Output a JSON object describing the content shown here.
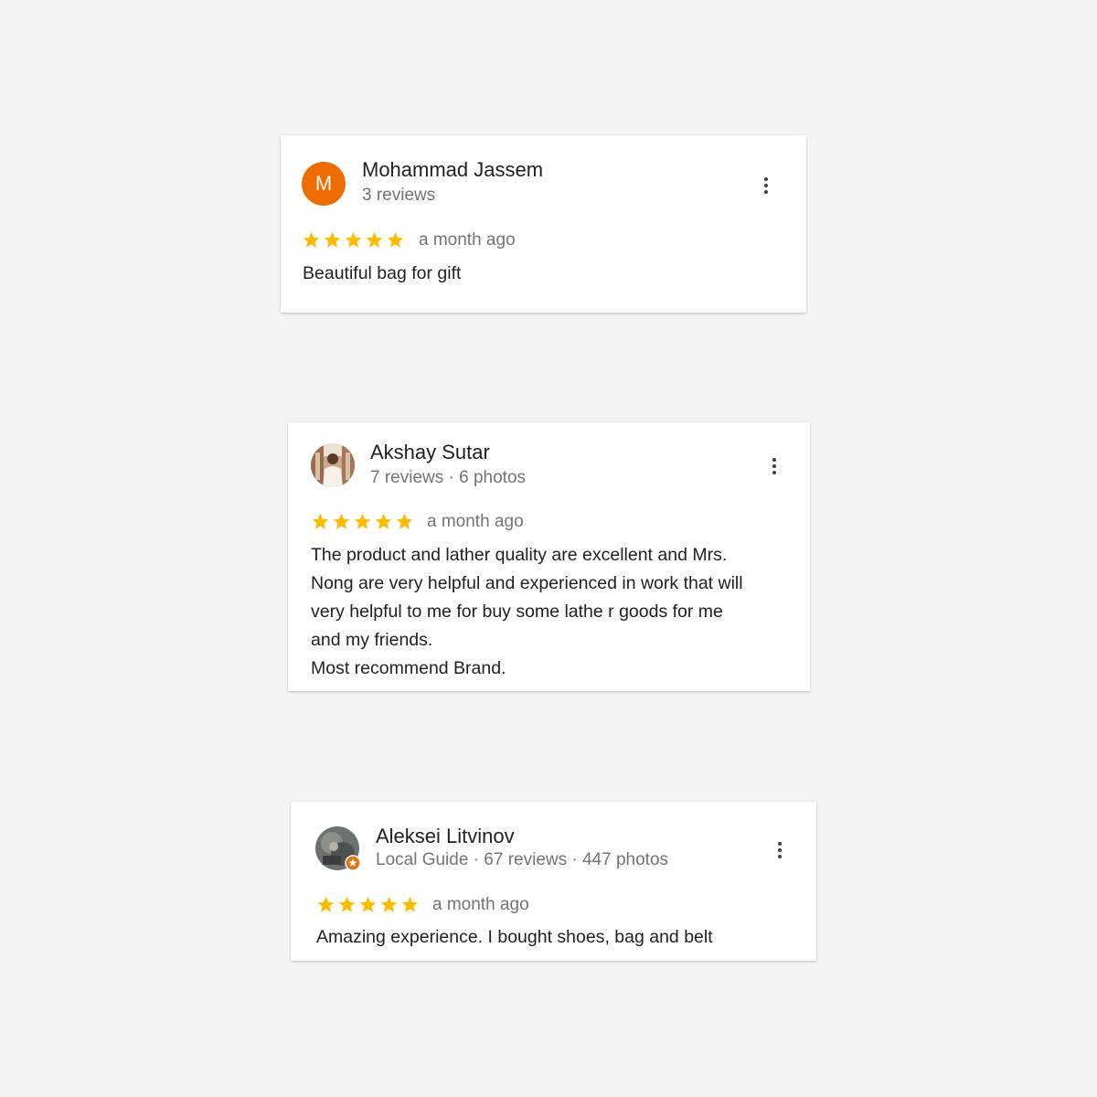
{
  "colors": {
    "background": "#f4f4f4",
    "star": "#fbbc04",
    "avatar_letter_bg": "#ef6c00",
    "meta_text": "#70757a",
    "local_guide_badge": "#e8710a"
  },
  "reviews": [
    {
      "author": "Mohammad Jassem",
      "avatar_letter": "M",
      "meta": "3 reviews",
      "rating": 5,
      "date": "a month ago",
      "text_lines": [
        "Beautiful bag for gift"
      ]
    },
    {
      "author": "Akshay Sutar",
      "avatar_icon": "profile-photo",
      "meta": "7 reviews · 6 photos",
      "rating": 5,
      "date": "a month ago",
      "text_lines": [
        "The product and lather quality are excellent and Mrs.",
        "Nong are very helpful and experienced in work that will",
        "very helpful to me for buy some lathe r goods for me",
        "and my friends.",
        "Most recommend Brand."
      ]
    },
    {
      "author": "Aleksei Litvinov",
      "avatar_icon": "profile-photo",
      "meta": "Local Guide · 67 reviews · 447 photos",
      "rating": 5,
      "date": "a month ago",
      "text_lines": [
        "Amazing experience. I bought shoes, bag and belt"
      ]
    }
  ]
}
